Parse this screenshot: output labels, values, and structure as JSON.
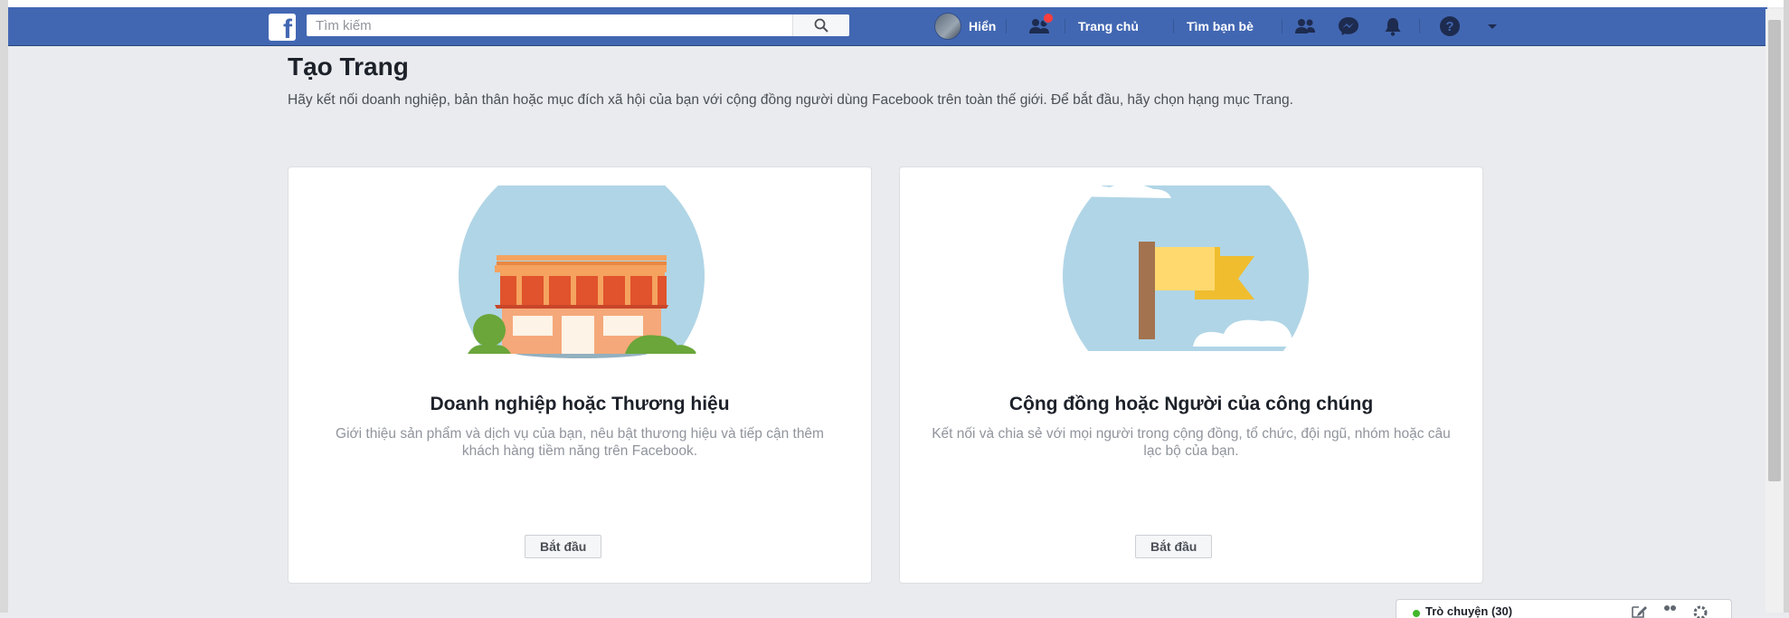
{
  "topbar": {
    "logo_letter": "f",
    "search_placeholder": "Tìm kiếm",
    "user_name": "Hiển",
    "nav_home": "Trang chủ",
    "nav_find_friends": "Tìm bạn bè",
    "color": "#4267b2",
    "icons": [
      "friend-requests-icon",
      "people-icon",
      "messenger-icon",
      "notifications-bell-icon",
      "help-icon",
      "account-menu-chevron-icon"
    ]
  },
  "page": {
    "title": "Tạo Trang",
    "description": "Hãy kết nối doanh nghiệp, bản thân hoặc mục đích xã hội của bạn với cộng đồng người dùng Facebook trên toàn thế giới. Để bắt đầu, hãy chọn hạng mục Trang."
  },
  "cards": [
    {
      "title": "Doanh nghiệp hoặc Thương hiệu",
      "description": "Giới thiệu sản phẩm và dịch vụ của bạn, nêu bật thương hiệu và tiếp cận thêm khách hàng tiềm năng trên Facebook.",
      "button": "Bắt đầu",
      "illustration": "storefront-illustration"
    },
    {
      "title": "Cộng đồng hoặc Người của công chúng",
      "description": "Kết nối và chia sẻ với mọi người trong cộng đồng, tổ chức, đội ngũ, nhóm hoặc câu lạc bộ của bạn.",
      "button": "Bắt đầu",
      "illustration": "flag-illustration"
    }
  ],
  "chat": {
    "label": "Trò chuyện (30)",
    "status_color": "#42b72a"
  }
}
